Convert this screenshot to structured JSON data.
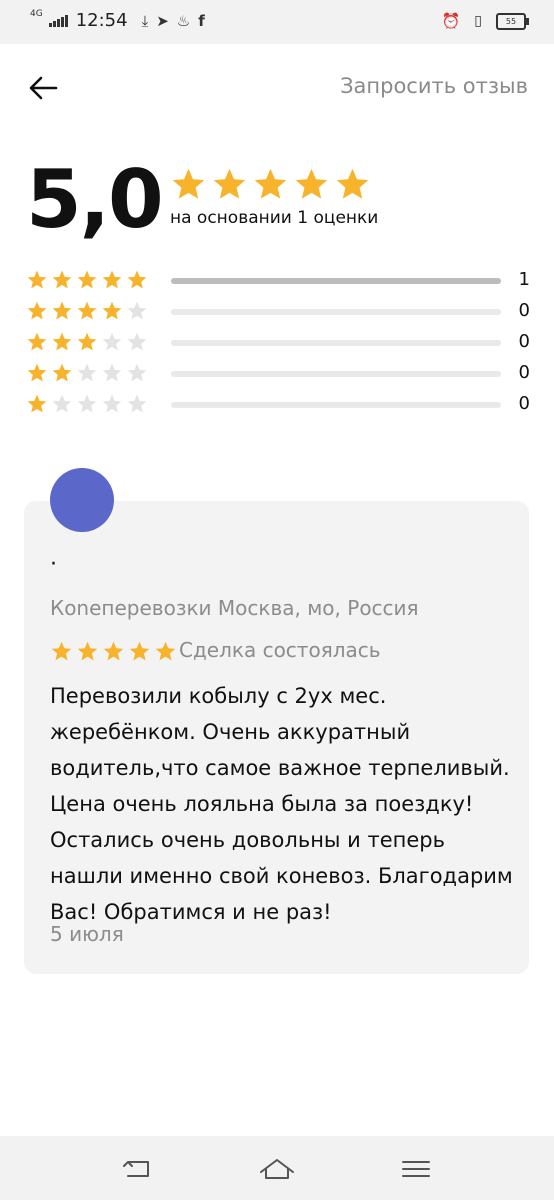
{
  "status_bar": {
    "network": "4G",
    "time": "12:54",
    "battery": "55",
    "icons": [
      "download-icon",
      "telegram-icon",
      "fire-icon",
      "facebook-icon",
      "alarm-icon",
      "vibrate-icon",
      "battery-icon"
    ]
  },
  "header": {
    "back_icon": "arrow-left-icon",
    "request_review_label": "Запросить отзыв"
  },
  "summary": {
    "rating": "5,0",
    "stars": 5,
    "basis": "на основании 1 оценки"
  },
  "breakdown": [
    {
      "stars": 5,
      "count": "1",
      "fraction": 1.0
    },
    {
      "stars": 4,
      "count": "0",
      "fraction": 0
    },
    {
      "stars": 3,
      "count": "0",
      "fraction": 0
    },
    {
      "stars": 2,
      "count": "0",
      "fraction": 0
    },
    {
      "stars": 1,
      "count": "0",
      "fraction": 0
    }
  ],
  "review": {
    "avatar_color": "#5b67c9",
    "author": "·",
    "location": "Коneперевозки Москва, мо, Россия",
    "stars": 5,
    "status": "Сделка состоялась",
    "text": "Перевозили кобылу с 2ух мес. жеребёнком. Очень аккуратный водитель,что самое важное терпеливый. Цена очень лояльна была за поездку! Остались очень довольны и теперь нашли именно свой коневоз. Благодарим Вас! Обратимся и не раз!",
    "date": "5 июля"
  },
  "colors": {
    "star_filled": "#f7b32b",
    "star_empty": "#e3e3e3",
    "muted_text": "#8c8c8c"
  },
  "nav_bar": {
    "icons": [
      "back-nav-icon",
      "home-nav-icon",
      "menu-nav-icon"
    ]
  }
}
